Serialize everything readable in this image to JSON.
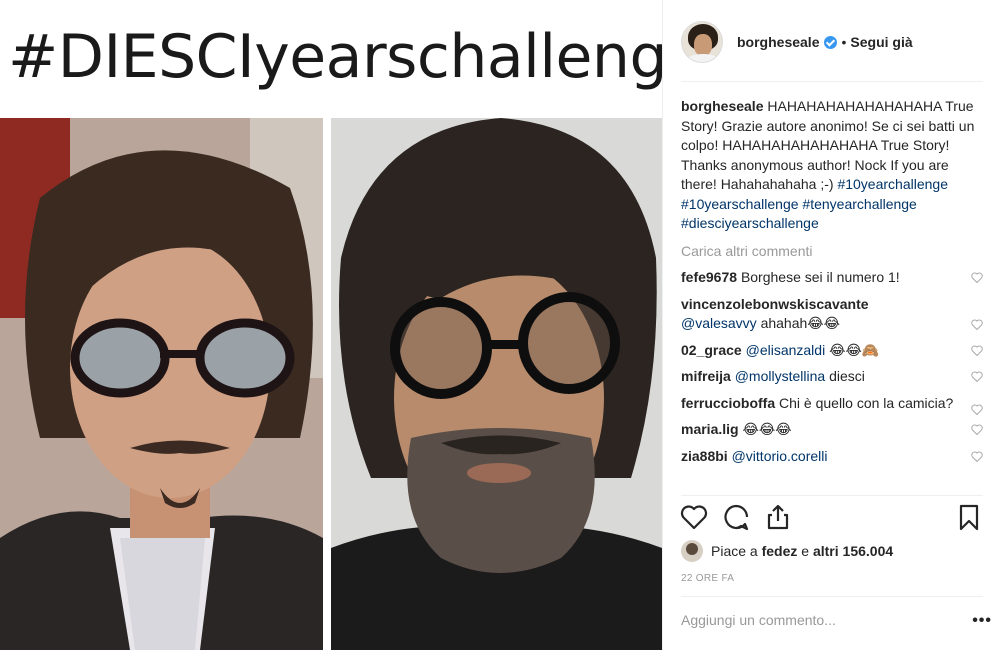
{
  "post": {
    "headline": "#DIESCIyearschallenge"
  },
  "header": {
    "username": "borgheseale",
    "separator": "•",
    "follow_label": "Segui già"
  },
  "caption": {
    "username": "borgheseale",
    "text": "HAHAHAHAHAHAHAHAHA True Story! Grazie autore anonimo! Se ci sei batti un colpo! HAHAHAHAHAHAHAHA True Story! Thanks anonymous author! Nock If you are there! Hahahahahaha ;-)",
    "hashtags": [
      "#10yearchallenge",
      "#10yearschallenge",
      "#tenyearchallenge",
      "#diesciyearschallenge"
    ]
  },
  "load_more": "Carica altri commenti",
  "comments": [
    {
      "user": "fefe9678",
      "mention": "",
      "text": "Borghese sei il numero 1!"
    },
    {
      "user": "vincenzolebonwskiscavante",
      "mention": "@valesavvy",
      "text": "ahahah😂😂"
    },
    {
      "user": "02_grace",
      "mention": "@elisanzaldi",
      "text": "😂😂🙈"
    },
    {
      "user": "mifreija",
      "mention": "@mollystellina",
      "text": "diesci"
    },
    {
      "user": "ferruccioboffa",
      "mention": "",
      "text": "Chi è quello con la camicia?"
    },
    {
      "user": "maria.lig",
      "mention": "",
      "text": "😂😂😂"
    },
    {
      "user": "zia88bi",
      "mention": "@vittorio.corelli",
      "text": ""
    }
  ],
  "likes": {
    "prefix": "Piace a",
    "user": "fedez",
    "connector": "e",
    "others": "altri 156.004"
  },
  "timestamp": "22 ORE FA",
  "add_comment_placeholder": "Aggiungi un commento...",
  "more_label": "•••",
  "icons": {
    "like": "heart-icon",
    "comment": "comment-icon",
    "share": "share-icon",
    "save": "bookmark-icon",
    "verified": "verified-badge-icon"
  },
  "colors": {
    "hashtag": "#003569",
    "verified": "#3897f0",
    "muted": "#999999",
    "text": "#262626"
  }
}
